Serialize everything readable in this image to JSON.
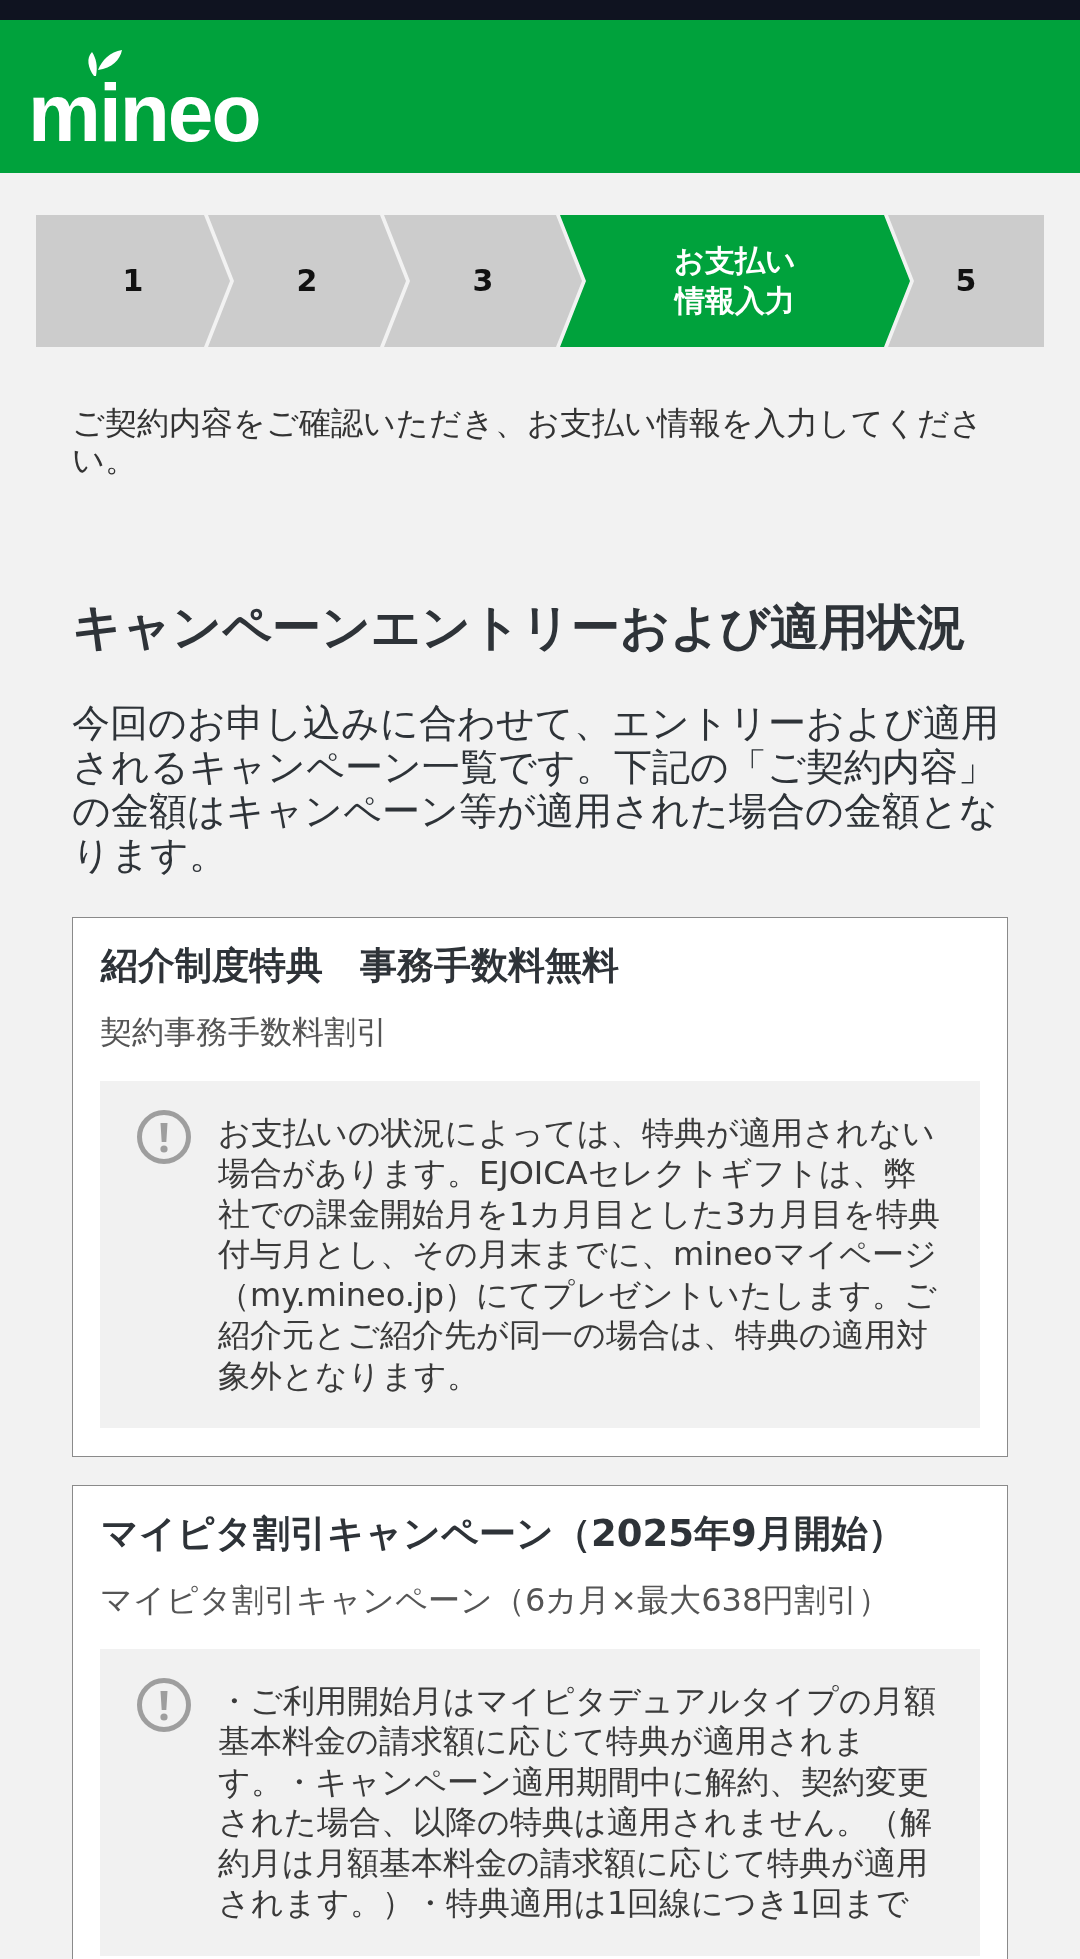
{
  "header": {
    "logo": "mineo"
  },
  "steps": [
    {
      "label": "1",
      "selected": false
    },
    {
      "label": "2",
      "selected": false
    },
    {
      "label": "3",
      "selected": false
    },
    {
      "label": "お支払い情報入力",
      "selected": true
    },
    {
      "label": "5",
      "selected": false
    }
  ],
  "intro": "ご契約内容をご確認いただき、お支払い情報を入力してください。",
  "section": {
    "heading": "キャンペーンエントリーおよび適用状況",
    "description": "今回のお申し込みに合わせて、エントリーおよび適用されるキャンペーン一覧です。下記の「ご契約内容」の金額はキャンペーン等が適用された場合の金額となります。"
  },
  "campaigns": [
    {
      "title": "紹介制度特典　事務手数料無料",
      "subtitle": "契約事務手数料割引",
      "note": "お支払いの状況によっては、特典が適用されない場合があります。EJOICAセレクトギフトは、弊社での課金開始月を1カ月目とした3カ月目を特典付与月とし、その月末までに、mineoマイページ（my.mineo.jp）にてプレゼントいたします。ご紹介元とご紹介先が同一の場合は、特典の適用対象外となります。"
    },
    {
      "title": "マイピタ割引キャンペーン（2025年9月開始）",
      "subtitle": "マイピタ割引キャンペーン（6カ月×最大638円割引）",
      "note": "・ご利用開始月はマイピタデュアルタイプの月額基本料金の請求額に応じて特典が適用されます。・キャンペーン適用期間中に解約、契約変更された場合、以降の特典は適用されません。（解約月は月額基本料金の請求額に応じて特典が適用されます。）・特典適用は1回線につき1回まで"
    }
  ]
}
